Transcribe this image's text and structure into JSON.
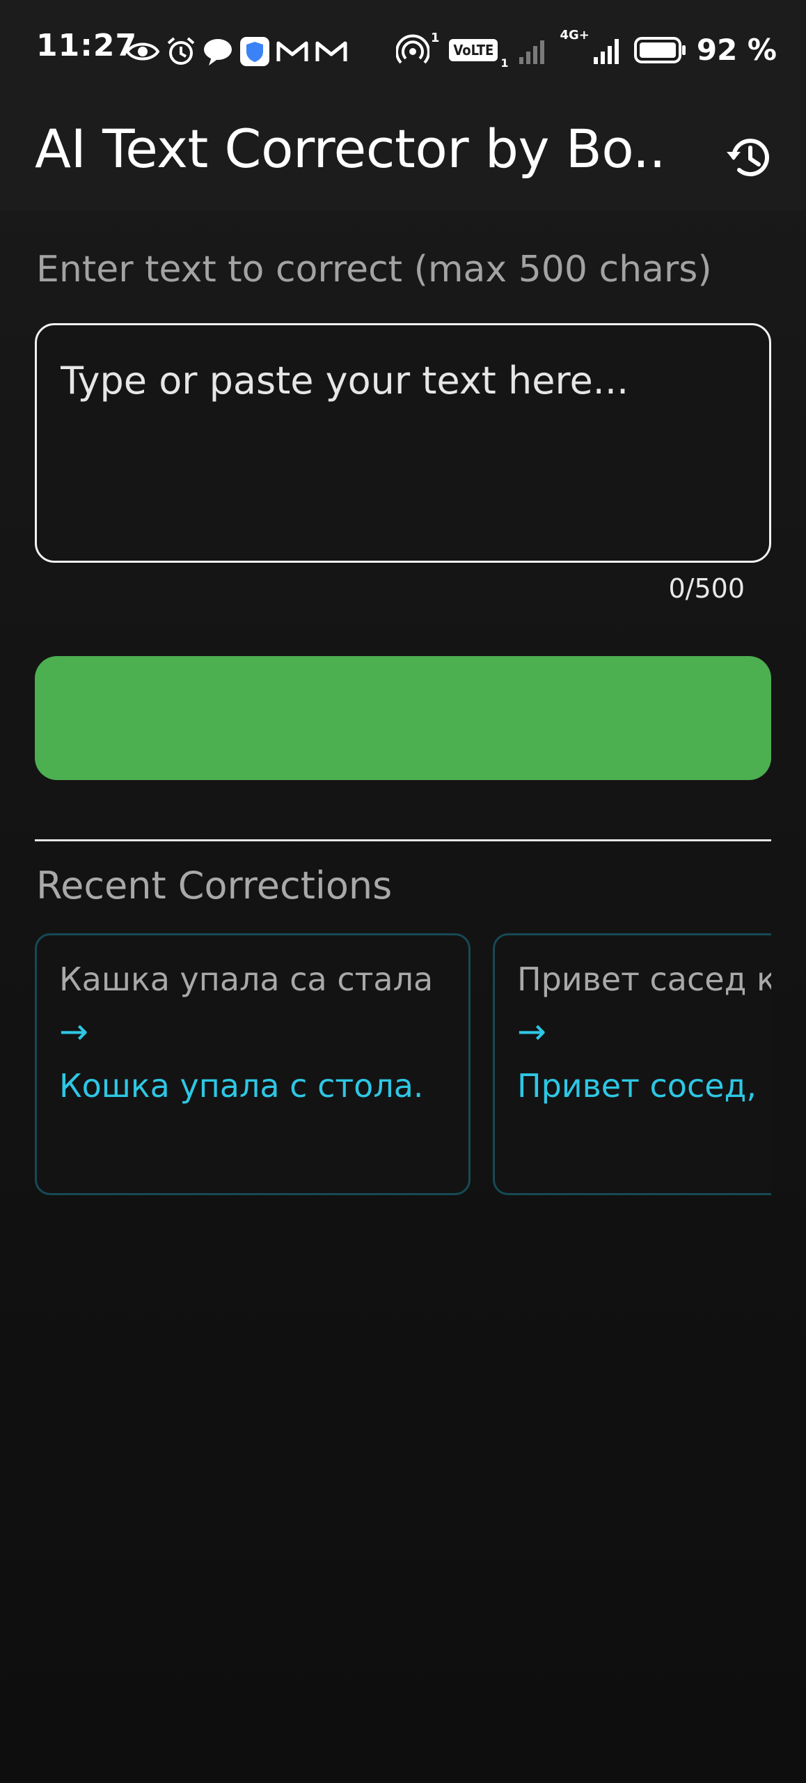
{
  "status_bar": {
    "time": "11:27",
    "left_icons": [
      "eye-icon",
      "alarm-icon",
      "chat-bubble-icon",
      "shield-icon",
      "gmail-icon",
      "gmail-icon"
    ],
    "hotspot_sup": "1",
    "volte": "VoLTE",
    "volte_sub": "1",
    "network": "4G+",
    "battery_percent": "92 %"
  },
  "app_bar": {
    "title": "AI Text Corrector by Bo...",
    "history_icon": "history-icon"
  },
  "input": {
    "label": "Enter text to correct (max 500 chars)",
    "placeholder": "Type or paste your text here...",
    "value": "",
    "char_count": "0/500"
  },
  "correct_button": {
    "label": "",
    "color": "#4caf50"
  },
  "recent": {
    "title": "Recent Corrections",
    "arrow": "→",
    "items": [
      {
        "original": "Кашка упала са стала",
        "corrected": "Кошка упала с стола."
      },
      {
        "original": "Привет сасед к",
        "corrected": "Привет сосед, "
      }
    ]
  },
  "colors": {
    "background": "#121212",
    "accent_green": "#4caf50",
    "accent_cyan": "#2ec7e4",
    "card_border": "#164a55"
  }
}
